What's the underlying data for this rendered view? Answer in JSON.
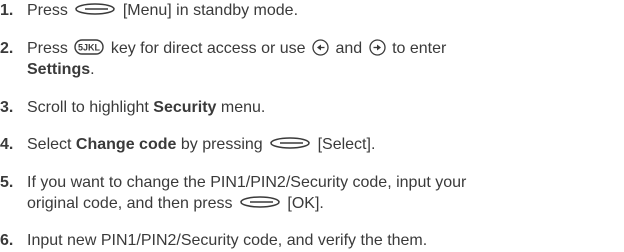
{
  "steps": [
    {
      "number": "1.",
      "pre": "Press",
      "post": "[Menu] in standby mode."
    },
    {
      "number": "2.",
      "pre": "Press",
      "mid1": "key for direct access or use",
      "mid2": "and",
      "mid3": "to enter",
      "line2_bold": "Settings",
      "line2_end": ".",
      "key5_label": "5JKL"
    },
    {
      "number": "3.",
      "pre": "Scroll to highlight",
      "bold": "Security",
      "post": "menu."
    },
    {
      "number": "4.",
      "pre": "Select",
      "bold": "Change code",
      "mid": "by pressing",
      "post": "[Select]."
    },
    {
      "number": "5.",
      "line1": "If you want to change the PIN1/PIN2/Security code, input your",
      "line2_pre": "original code, and then press",
      "line2_post": "[OK]."
    },
    {
      "number": "6.",
      "text": "Input new PIN1/PIN2/Security code, and verify the them."
    }
  ],
  "icons": {
    "soft_key": "soft-key-icon",
    "key_5": "key-5-icon",
    "nav_left": "nav-left-icon",
    "nav_right": "nav-right-icon"
  }
}
